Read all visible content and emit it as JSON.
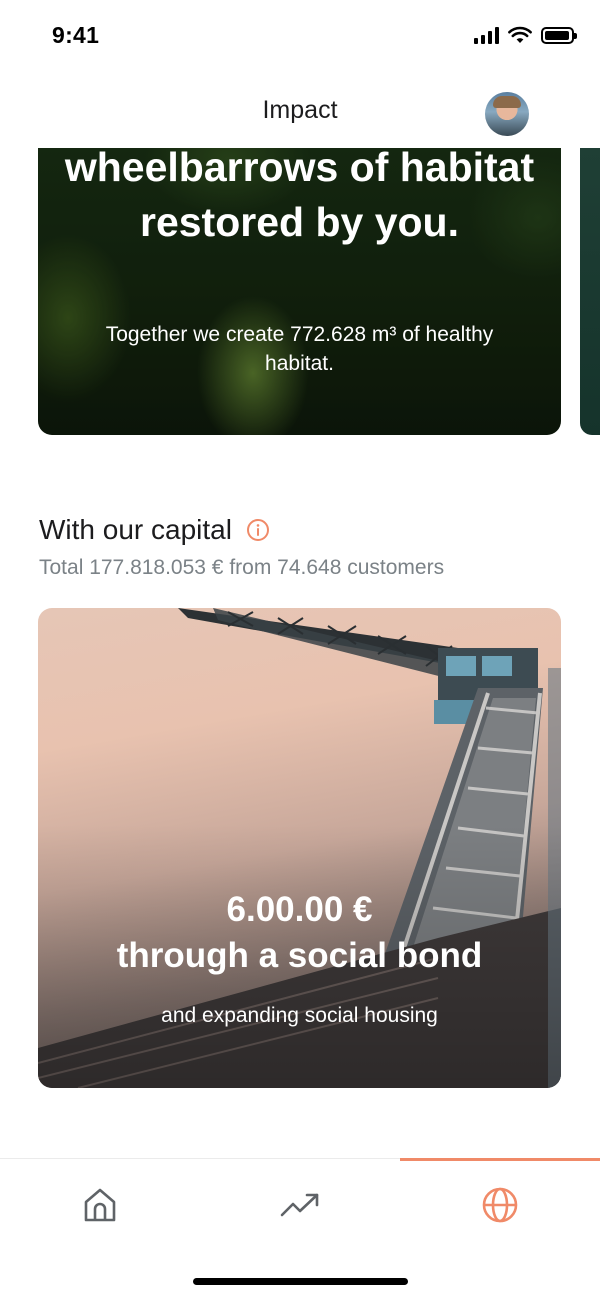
{
  "status_bar": {
    "time": "9:41"
  },
  "header": {
    "title": "Impact"
  },
  "habitat_card": {
    "headline": "wheelbarrows of habitat restored by you.",
    "subtitle": "Together we create 772.628  m³ of healthy habitat."
  },
  "capital": {
    "title": "With our capital",
    "subtitle": "Total 177.818.053 € from 74.648 customers"
  },
  "bond_card": {
    "amount": "6.00.00 €",
    "title": "through a social bond",
    "subtitle": "and expanding social housing"
  },
  "tab_bar": {
    "tabs": [
      {
        "icon": "home-icon",
        "active": false
      },
      {
        "icon": "trending-up-icon",
        "active": false
      },
      {
        "icon": "globe-icon",
        "active": true
      }
    ],
    "active_color": "#f08a68",
    "inactive_color": "#5f6367"
  },
  "colors": {
    "accent": "#f08a68",
    "muted_text": "#7b8287"
  }
}
